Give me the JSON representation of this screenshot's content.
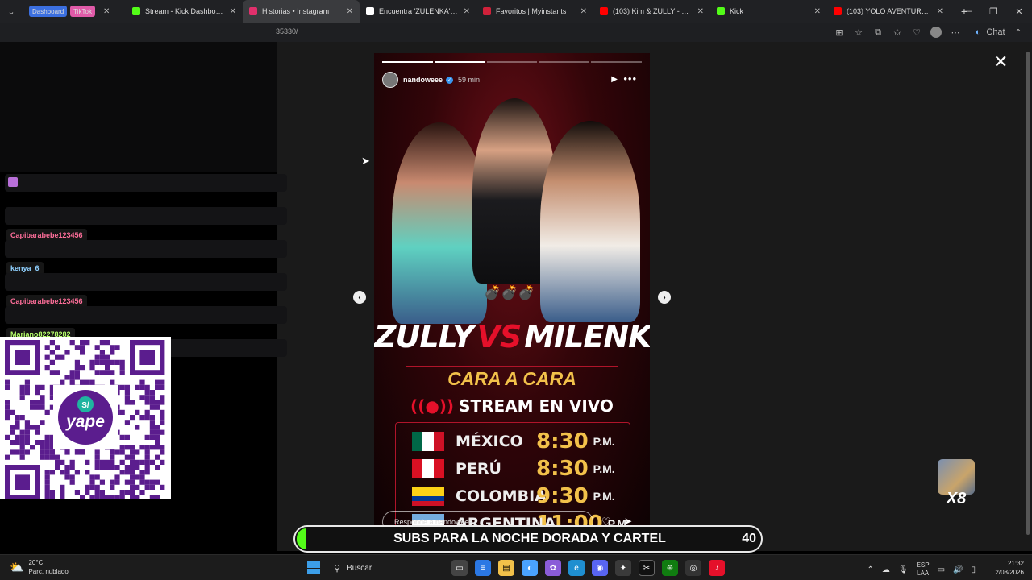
{
  "browser": {
    "tabs": [
      {
        "label": "",
        "chips": [
          "Dashboard",
          "TikTok"
        ],
        "chip_colors": [
          "#3b6fe0",
          "#e05aa8"
        ],
        "fav_color": "#000000",
        "active": false
      },
      {
        "label": "Stream - Kick Dashboard",
        "fav_color": "#53fc18",
        "active": false
      },
      {
        "label": "Historias • Instagram",
        "fav_color": "#e1306c",
        "active": true
      },
      {
        "label": "Encuentra 'ZULENKA' en TikTok",
        "fav_color": "#ffffff",
        "active": false
      },
      {
        "label": "Favoritos | Myinstants",
        "fav_color": "#d0213a",
        "active": false
      },
      {
        "label": "(103) Kim & ZULLY - MÁ",
        "fav_color": "#ff0000",
        "active": false
      },
      {
        "label": "Kick",
        "fav_color": "#53fc18",
        "active": false
      },
      {
        "label": "(103) YOLO AVENTURAS - You",
        "fav_color": "#ff0000",
        "active": false
      }
    ],
    "url_fragment": "35330/",
    "chat_label": "Chat"
  },
  "chat": {
    "messages": [
      {
        "user": "",
        "user_color": "#ffffff",
        "emote_count": 1
      },
      {
        "user": "Capibarabebe123456",
        "user_color": "#ff6e9a",
        "emote_count": 3
      },
      {
        "user": "kenya_6",
        "user_color": "#8fd0ff",
        "emote_count": 11
      },
      {
        "user": "Capibarabebe123456",
        "user_color": "#ff6e9a",
        "emote_count": 2
      },
      {
        "user": "Mariano82278282",
        "user_color": "#b5ff6a",
        "emote_count": 1
      },
      {
        "user": "kenya_6",
        "user_color": "#8fd0ff",
        "emote_count": 0
      }
    ]
  },
  "qr": {
    "brand": "yape",
    "coin_label": "S/",
    "color": "#5b1d8e"
  },
  "story": {
    "username": "nandoweee",
    "time": "59 min",
    "segments_total": 5,
    "segments_done": 2,
    "headline_left": "ZULLY",
    "headline_vs": "VS",
    "headline_right": "MILENKA",
    "subtitle": "CARA A CARA",
    "live_label": "STREAM EN VIVO",
    "schedule": [
      {
        "country": "MÉXICO",
        "time": "8:30",
        "ampm": "P.M.",
        "flag": [
          "#006847",
          "#ffffff",
          "#ce1126"
        ],
        "flag_dir": "v"
      },
      {
        "country": "PERÚ",
        "time": "8:30",
        "ampm": "P.M.",
        "flag": [
          "#d91023",
          "#ffffff",
          "#d91023"
        ],
        "flag_dir": "v"
      },
      {
        "country": "COLOMBIA",
        "time": "9:30",
        "ampm": "P.M.",
        "flag": [
          "#fcd116",
          "#fcd116",
          "#003893",
          "#ce1126"
        ],
        "flag_dir": "h"
      },
      {
        "country": "ARGENTINA",
        "time": "11:00",
        "ampm": "P.M.",
        "flag": [
          "#74acdf",
          "#ffffff",
          "#74acdf"
        ],
        "flag_dir": "h"
      }
    ],
    "reply_placeholder": "Responde a nandoweee..."
  },
  "overlay": {
    "sub_goal_label": "SUBS PARA LA NOCHE DORADA Y CARTEL",
    "sub_goal_count": "40",
    "sub_goal_progress": 0.02,
    "combo_label": "X8"
  },
  "taskbar": {
    "weather_temp": "20°C",
    "weather_desc": "Parc. nublado",
    "search_label": "Buscar",
    "lang_top": "ESP",
    "lang_bottom": "LAA",
    "time": "21:32",
    "date": "2/08/2026"
  },
  "colors": {
    "accent_kick": "#53fc18",
    "story_red": "#e5102a",
    "story_gold": "#f2c14a"
  }
}
